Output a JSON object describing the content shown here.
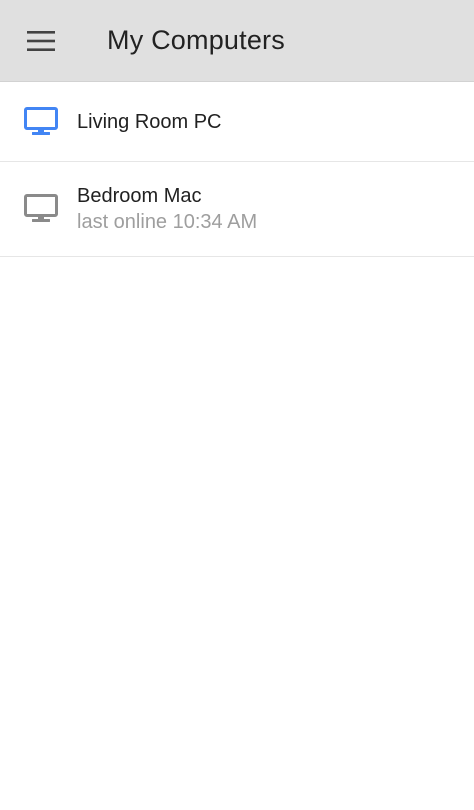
{
  "header": {
    "title": "My Computers",
    "menu_icon": "hamburger-menu-icon"
  },
  "computers": [
    {
      "name": "Living Room PC",
      "status": "",
      "online": true,
      "icon": "monitor-icon",
      "icon_color": "#4285f4"
    },
    {
      "name": "Bedroom Mac",
      "status": "last online 10:34 AM",
      "online": false,
      "icon": "monitor-icon",
      "icon_color": "#8a8a8a"
    }
  ],
  "colors": {
    "toolbar_bg": "#e0e0e0",
    "online_accent": "#4285f4",
    "offline_icon": "#8a8a8a",
    "secondary_text": "#9e9e9e"
  }
}
